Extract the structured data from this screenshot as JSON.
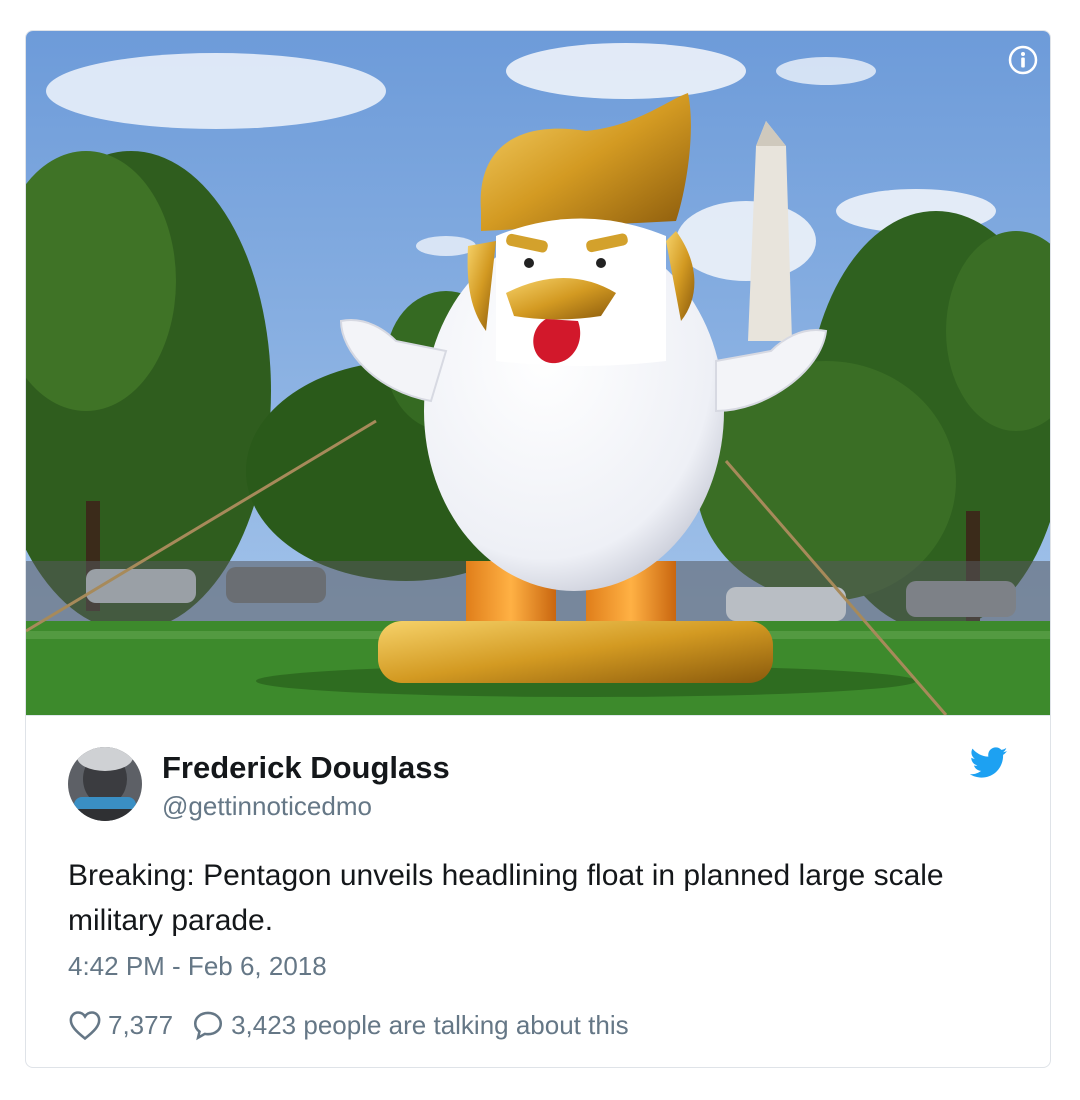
{
  "tweet": {
    "author_name": "Frederick Douglass",
    "author_handle": "@gettinnoticedmo",
    "text": "Breaking: Pentagon unveils headlining float in planned large scale military parade.",
    "timestamp": "4:42 PM - Feb 6, 2018",
    "likes": "7,377",
    "conversation": "3,423 people are talking about this"
  },
  "icons": {
    "info": "info-icon",
    "brand": "twitter-bird-icon",
    "like": "heart-icon",
    "reply": "speech-bubble-icon"
  },
  "colors": {
    "brand": "#1da1f2",
    "secondary_text": "#657786",
    "primary_text": "#14171a",
    "border": "#dfe3e8"
  }
}
